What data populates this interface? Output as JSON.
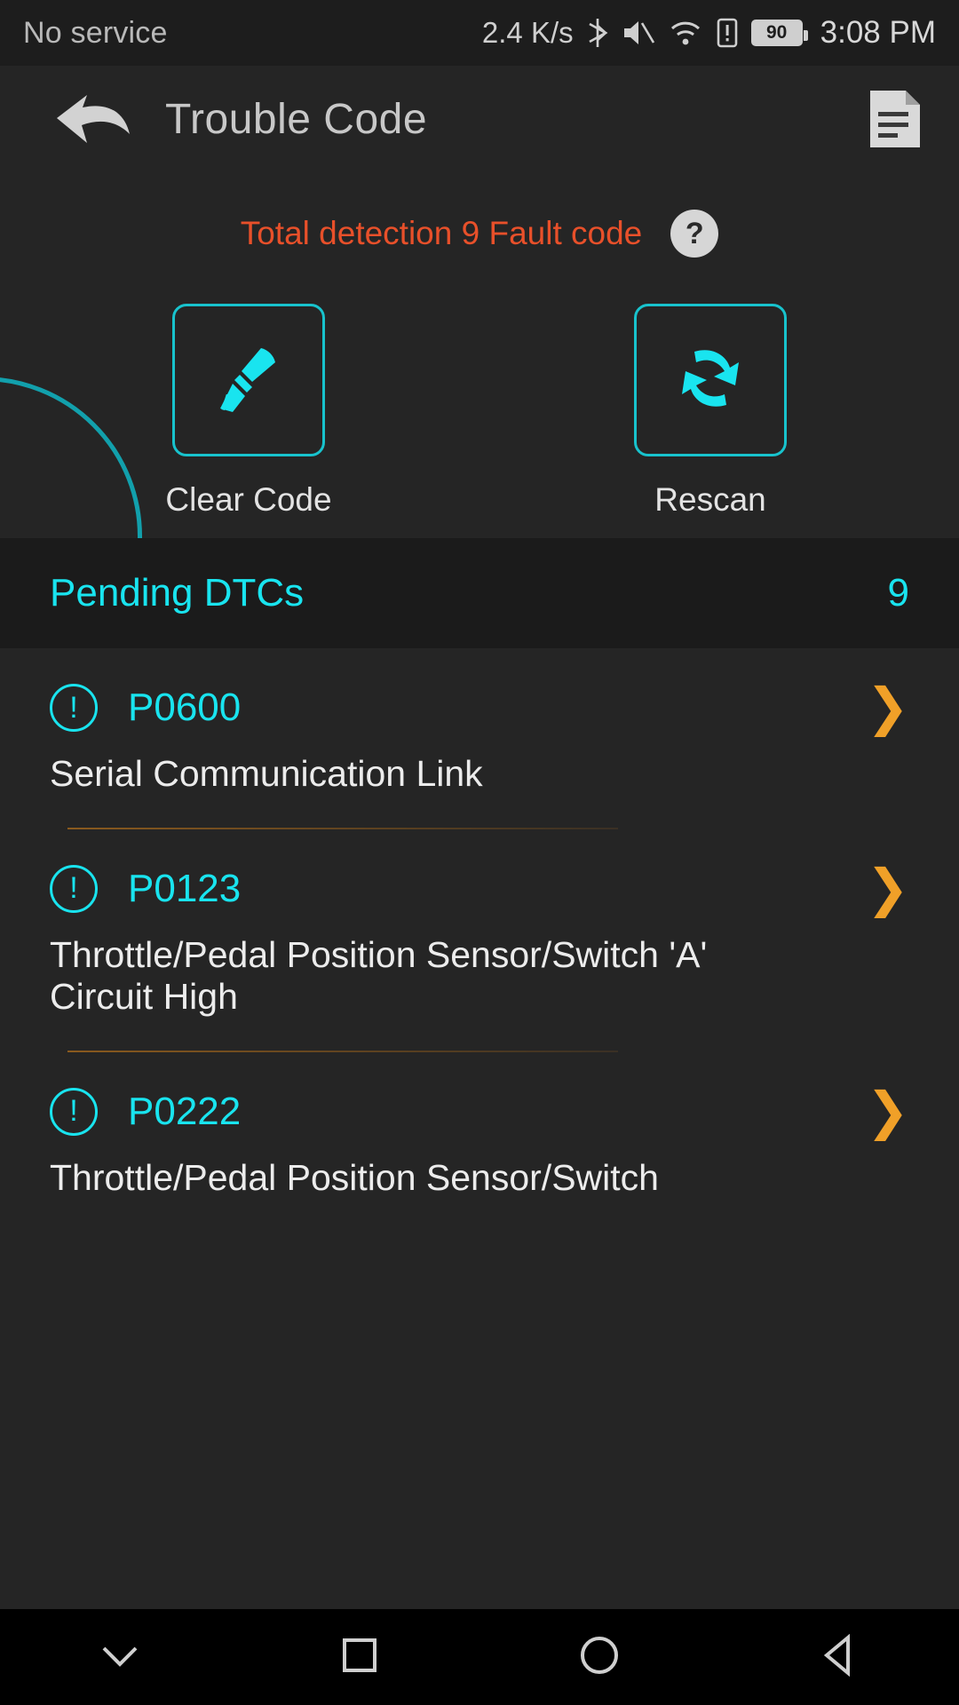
{
  "statusbar": {
    "carrier": "No service",
    "net_speed": "2.4 K/s",
    "icons": [
      "bluetooth-icon",
      "mute-icon",
      "wifi-icon",
      "sim-alert-icon"
    ],
    "battery_level": "90",
    "time": "3:08 PM"
  },
  "titlebar": {
    "back_icon": "back-arrow-icon",
    "title": "Trouble Code",
    "report_icon": "report-document-icon"
  },
  "top_panel": {
    "detection_text": "Total detection 9 Fault code",
    "help_label": "?",
    "detection_color": "#e8502a",
    "accent_color": "#19e4ef",
    "actions": [
      {
        "icon": "broom-icon",
        "label": "Clear Code"
      },
      {
        "icon": "refresh-icon",
        "label": "Rescan"
      }
    ]
  },
  "section": {
    "title": "Pending DTCs",
    "count": "9"
  },
  "dtc_list": [
    {
      "icon": "warning-circle-icon",
      "code": "P0600",
      "description": "Serial Communication Link",
      "chevron": "❯"
    },
    {
      "icon": "warning-circle-icon",
      "code": "P0123",
      "description": "Throttle/Pedal Position Sensor/Switch 'A' Circuit High",
      "chevron": "❯"
    },
    {
      "icon": "warning-circle-icon",
      "code": "P0222",
      "description": "Throttle/Pedal Position Sensor/Switch",
      "chevron": "❯"
    }
  ],
  "navbar": {
    "buttons": [
      {
        "name": "hide-keyboard-button",
        "icon": "chevron-down-icon"
      },
      {
        "name": "recents-button",
        "icon": "square-icon"
      },
      {
        "name": "home-button",
        "icon": "circle-icon"
      },
      {
        "name": "back-button",
        "icon": "triangle-left-icon"
      }
    ]
  }
}
